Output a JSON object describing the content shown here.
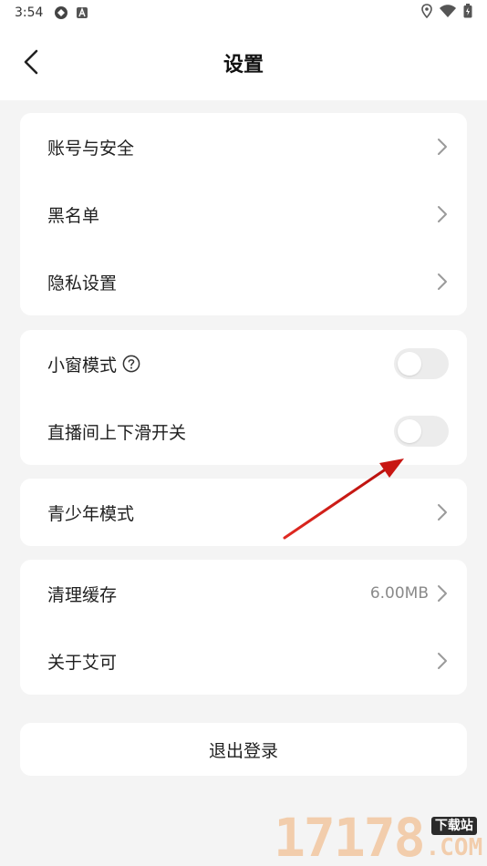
{
  "status_bar": {
    "time": "3:54"
  },
  "header": {
    "title": "设置"
  },
  "groups": [
    {
      "items": [
        {
          "label": "账号与安全"
        },
        {
          "label": "黑名单"
        },
        {
          "label": "隐私设置"
        }
      ]
    },
    {
      "items": [
        {
          "label": "小窗模式",
          "toggle_on": false
        },
        {
          "label": "直播间上下滑开关",
          "toggle_on": false
        }
      ]
    },
    {
      "items": [
        {
          "label": "青少年模式"
        }
      ]
    },
    {
      "items": [
        {
          "label": "清理缓存",
          "value": "6.00MB"
        },
        {
          "label": "关于艾可"
        }
      ]
    }
  ],
  "logout": {
    "label": "退出登录"
  },
  "watermark": {
    "digits": "17178",
    "tag": "下载站",
    "domain": ".COM"
  },
  "colors": {
    "background": "#f4f4f4",
    "card": "#ffffff",
    "toggle_off": "#ececec",
    "annotation_arrow": "#d8201c"
  }
}
